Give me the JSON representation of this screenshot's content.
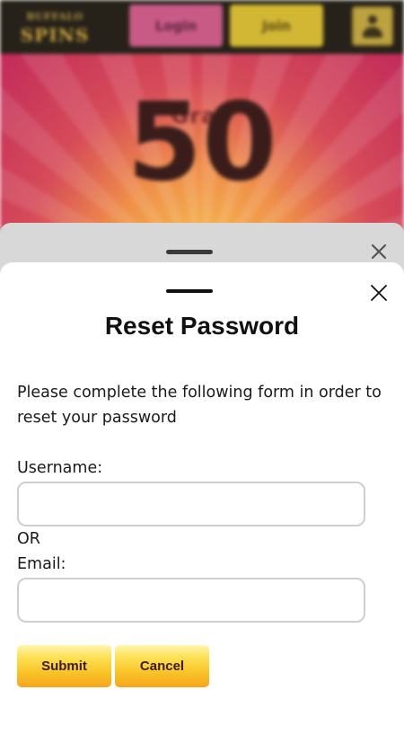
{
  "background": {
    "logo_line1": "BUFFALO",
    "logo_line2": "SPINS",
    "login_label": "Login",
    "join_label": "Join",
    "hero_small": "Grab",
    "hero_big": "50"
  },
  "modal": {
    "title": "Reset Password",
    "description": "Please complete the following form in order to reset your password",
    "username_label": "Username:",
    "username_value": "",
    "or_label": "OR",
    "email_label": "Email:",
    "email_value": "",
    "submit_label": "Submit",
    "cancel_label": "Cancel"
  },
  "icons": {
    "close": "close-icon",
    "user": "user-icon"
  },
  "colors": {
    "accent_top": "#fde156",
    "accent_bottom": "#f7a41d",
    "button_text": "#3a1c1c"
  }
}
